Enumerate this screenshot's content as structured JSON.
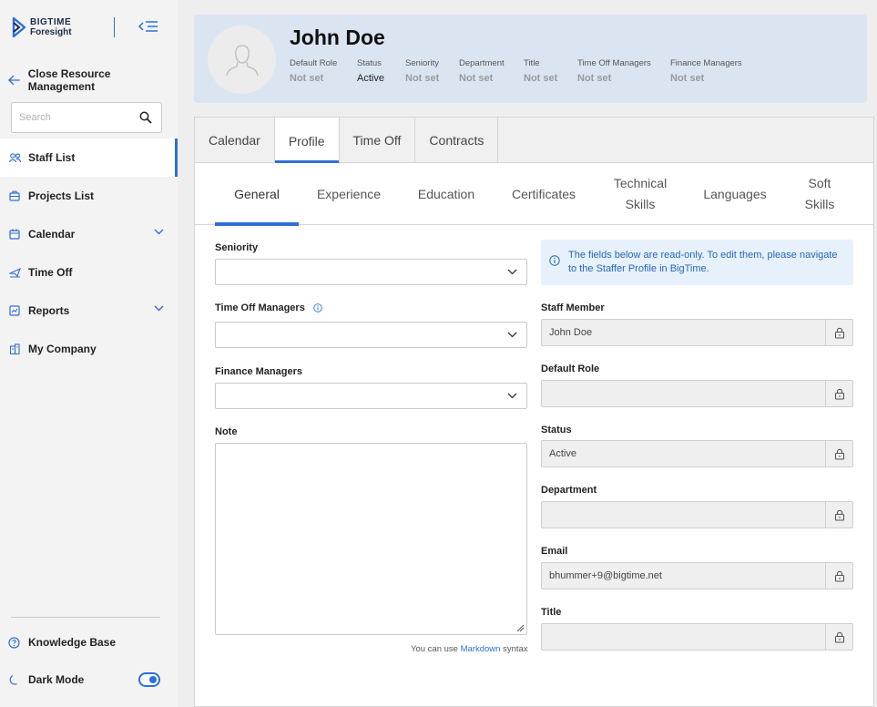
{
  "brand": {
    "line1": "BIGTIME",
    "line2": "Foresight",
    "accent": "#2f6fd6"
  },
  "sidebar": {
    "back_label": "Close Resource Management",
    "search_placeholder": "Search",
    "items": [
      {
        "label": "Staff List",
        "icon": "people-icon",
        "active": true
      },
      {
        "label": "Projects List",
        "icon": "briefcase-icon"
      },
      {
        "label": "Calendar",
        "icon": "calendar-icon",
        "expandable": true
      },
      {
        "label": "Time Off",
        "icon": "plane-icon"
      },
      {
        "label": "Reports",
        "icon": "report-icon",
        "expandable": true
      },
      {
        "label": "My Company",
        "icon": "building-icon"
      }
    ],
    "knowledge_base": "Knowledge Base",
    "dark_mode": "Dark Mode"
  },
  "profile": {
    "name": "John Doe",
    "meta": [
      {
        "label": "Default Role",
        "value": "Not set"
      },
      {
        "label": "Status",
        "value": "Active"
      },
      {
        "label": "Seniority",
        "value": "Not set"
      },
      {
        "label": "Department",
        "value": "Not set"
      },
      {
        "label": "Title",
        "value": "Not set"
      },
      {
        "label": "Time Off Managers",
        "value": "Not set"
      },
      {
        "label": "Finance Managers",
        "value": "Not set"
      }
    ]
  },
  "tabs": [
    "Calendar",
    "Profile",
    "Time Off",
    "Contracts"
  ],
  "subtabs": [
    "General",
    "Experience",
    "Education",
    "Certificates",
    "Technical Skills",
    "Languages",
    "Soft Skills"
  ],
  "form": {
    "seniority_label": "Seniority",
    "time_off_managers_label": "Time Off Managers",
    "finance_managers_label": "Finance Managers",
    "note_label": "Note",
    "markdown_hint_prefix": "You can use",
    "markdown_link": "Markdown",
    "markdown_hint_suffix": "syntax"
  },
  "readonly": {
    "info": "The fields below are read-only. To edit them, please navigate to the Staffer Profile in BigTime.",
    "fields": [
      {
        "label": "Staff Member",
        "value": "John Doe"
      },
      {
        "label": "Default Role",
        "value": ""
      },
      {
        "label": "Status",
        "value": "Active"
      },
      {
        "label": "Department",
        "value": ""
      },
      {
        "label": "Email",
        "value": "bhummer+9@bigtime.net"
      },
      {
        "label": "Title",
        "value": ""
      }
    ]
  }
}
